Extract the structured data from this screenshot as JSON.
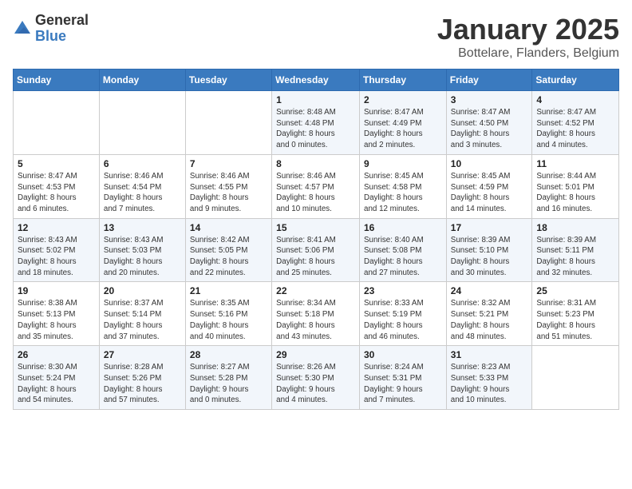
{
  "logo": {
    "general": "General",
    "blue": "Blue"
  },
  "title": "January 2025",
  "subtitle": "Bottelare, Flanders, Belgium",
  "weekdays": [
    "Sunday",
    "Monday",
    "Tuesday",
    "Wednesday",
    "Thursday",
    "Friday",
    "Saturday"
  ],
  "weeks": [
    [
      {
        "day": "",
        "info": ""
      },
      {
        "day": "",
        "info": ""
      },
      {
        "day": "",
        "info": ""
      },
      {
        "day": "1",
        "info": "Sunrise: 8:48 AM\nSunset: 4:48 PM\nDaylight: 8 hours and 0 minutes."
      },
      {
        "day": "2",
        "info": "Sunrise: 8:47 AM\nSunset: 4:49 PM\nDaylight: 8 hours and 2 minutes."
      },
      {
        "day": "3",
        "info": "Sunrise: 8:47 AM\nSunset: 4:50 PM\nDaylight: 8 hours and 3 minutes."
      },
      {
        "day": "4",
        "info": "Sunrise: 8:47 AM\nSunset: 4:52 PM\nDaylight: 8 hours and 4 minutes."
      }
    ],
    [
      {
        "day": "5",
        "info": "Sunrise: 8:47 AM\nSunset: 4:53 PM\nDaylight: 8 hours and 6 minutes."
      },
      {
        "day": "6",
        "info": "Sunrise: 8:46 AM\nSunset: 4:54 PM\nDaylight: 8 hours and 7 minutes."
      },
      {
        "day": "7",
        "info": "Sunrise: 8:46 AM\nSunset: 4:55 PM\nDaylight: 8 hours and 9 minutes."
      },
      {
        "day": "8",
        "info": "Sunrise: 8:46 AM\nSunset: 4:57 PM\nDaylight: 8 hours and 10 minutes."
      },
      {
        "day": "9",
        "info": "Sunrise: 8:45 AM\nSunset: 4:58 PM\nDaylight: 8 hours and 12 minutes."
      },
      {
        "day": "10",
        "info": "Sunrise: 8:45 AM\nSunset: 4:59 PM\nDaylight: 8 hours and 14 minutes."
      },
      {
        "day": "11",
        "info": "Sunrise: 8:44 AM\nSunset: 5:01 PM\nDaylight: 8 hours and 16 minutes."
      }
    ],
    [
      {
        "day": "12",
        "info": "Sunrise: 8:43 AM\nSunset: 5:02 PM\nDaylight: 8 hours and 18 minutes."
      },
      {
        "day": "13",
        "info": "Sunrise: 8:43 AM\nSunset: 5:03 PM\nDaylight: 8 hours and 20 minutes."
      },
      {
        "day": "14",
        "info": "Sunrise: 8:42 AM\nSunset: 5:05 PM\nDaylight: 8 hours and 22 minutes."
      },
      {
        "day": "15",
        "info": "Sunrise: 8:41 AM\nSunset: 5:06 PM\nDaylight: 8 hours and 25 minutes."
      },
      {
        "day": "16",
        "info": "Sunrise: 8:40 AM\nSunset: 5:08 PM\nDaylight: 8 hours and 27 minutes."
      },
      {
        "day": "17",
        "info": "Sunrise: 8:39 AM\nSunset: 5:10 PM\nDaylight: 8 hours and 30 minutes."
      },
      {
        "day": "18",
        "info": "Sunrise: 8:39 AM\nSunset: 5:11 PM\nDaylight: 8 hours and 32 minutes."
      }
    ],
    [
      {
        "day": "19",
        "info": "Sunrise: 8:38 AM\nSunset: 5:13 PM\nDaylight: 8 hours and 35 minutes."
      },
      {
        "day": "20",
        "info": "Sunrise: 8:37 AM\nSunset: 5:14 PM\nDaylight: 8 hours and 37 minutes."
      },
      {
        "day": "21",
        "info": "Sunrise: 8:35 AM\nSunset: 5:16 PM\nDaylight: 8 hours and 40 minutes."
      },
      {
        "day": "22",
        "info": "Sunrise: 8:34 AM\nSunset: 5:18 PM\nDaylight: 8 hours and 43 minutes."
      },
      {
        "day": "23",
        "info": "Sunrise: 8:33 AM\nSunset: 5:19 PM\nDaylight: 8 hours and 46 minutes."
      },
      {
        "day": "24",
        "info": "Sunrise: 8:32 AM\nSunset: 5:21 PM\nDaylight: 8 hours and 48 minutes."
      },
      {
        "day": "25",
        "info": "Sunrise: 8:31 AM\nSunset: 5:23 PM\nDaylight: 8 hours and 51 minutes."
      }
    ],
    [
      {
        "day": "26",
        "info": "Sunrise: 8:30 AM\nSunset: 5:24 PM\nDaylight: 8 hours and 54 minutes."
      },
      {
        "day": "27",
        "info": "Sunrise: 8:28 AM\nSunset: 5:26 PM\nDaylight: 8 hours and 57 minutes."
      },
      {
        "day": "28",
        "info": "Sunrise: 8:27 AM\nSunset: 5:28 PM\nDaylight: 9 hours and 0 minutes."
      },
      {
        "day": "29",
        "info": "Sunrise: 8:26 AM\nSunset: 5:30 PM\nDaylight: 9 hours and 4 minutes."
      },
      {
        "day": "30",
        "info": "Sunrise: 8:24 AM\nSunset: 5:31 PM\nDaylight: 9 hours and 7 minutes."
      },
      {
        "day": "31",
        "info": "Sunrise: 8:23 AM\nSunset: 5:33 PM\nDaylight: 9 hours and 10 minutes."
      },
      {
        "day": "",
        "info": ""
      }
    ]
  ]
}
